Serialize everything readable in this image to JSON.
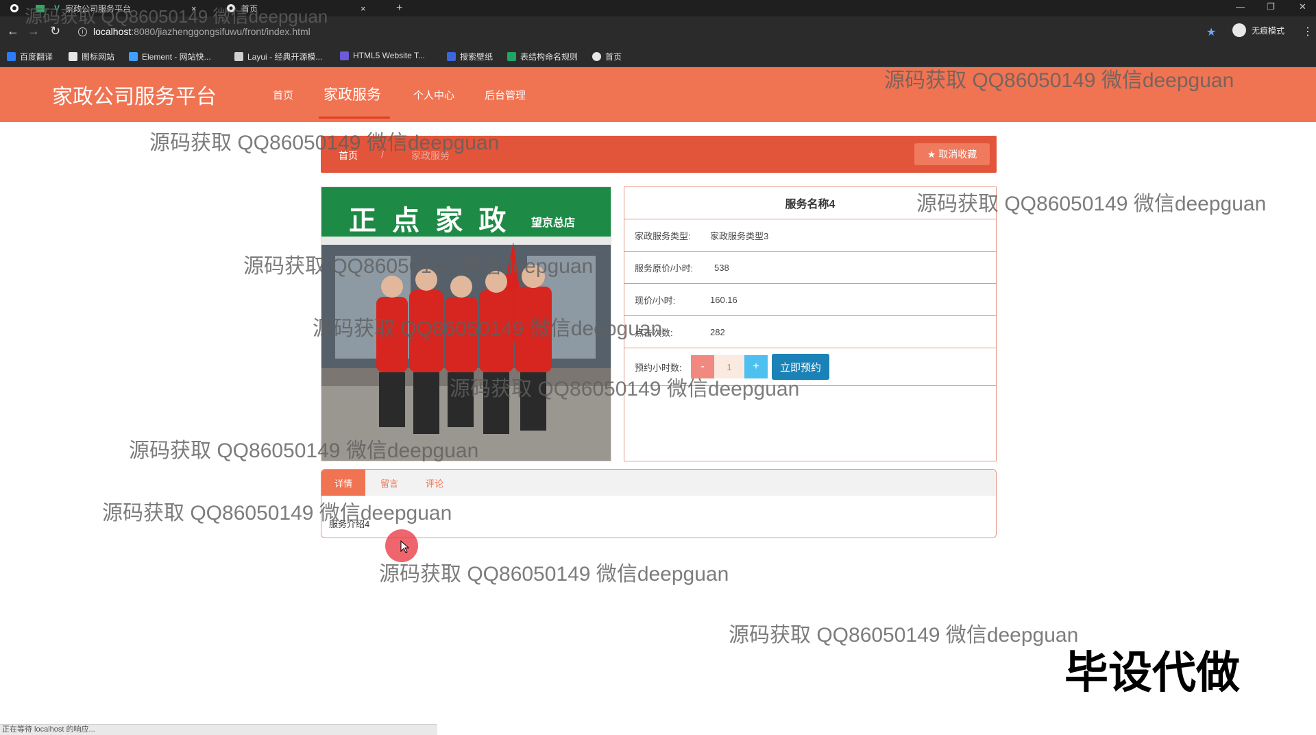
{
  "browser": {
    "tabs": [
      {
        "title": "家政公司服务平台",
        "active": false
      },
      {
        "title": "首页",
        "active": true
      }
    ],
    "new_tab": "+",
    "url_host": "localhost",
    "url_path": ":8080/jiazhenggongsifuwu/front/index.html",
    "incognito_label": "无痕模式",
    "bookmarks": [
      {
        "label": "百度翻译",
        "color": "#2e7bf6"
      },
      {
        "label": "图标网站",
        "color": "#e6e6e6"
      },
      {
        "label": "Element - 网站快...",
        "color": "#409eff"
      },
      {
        "label": "Layui - 经典开源模...",
        "color": "#cfcfcf"
      },
      {
        "label": "HTML5 Website T...",
        "color": "#6b5bd6"
      },
      {
        "label": "搜索壁纸",
        "color": "#3b67d8"
      },
      {
        "label": "表结构命名规则",
        "color": "#21a366"
      },
      {
        "label": "首页",
        "color": "#e6e6e6"
      }
    ],
    "status_text": "正在等待 localhost 的响应..."
  },
  "site": {
    "title": "家政公司服务平台",
    "nav": [
      "首页",
      "家政服务",
      "个人中心",
      "后台管理"
    ],
    "active_nav": "家政服务"
  },
  "breadcrumb": {
    "home": "首页",
    "separator": "/",
    "current": "家政服务"
  },
  "favorite_button": "★ 取消收藏",
  "service": {
    "name": "服务名称4",
    "fields": [
      {
        "label": "家政服务类型:",
        "value": "家政服务类型3"
      },
      {
        "label": "服务原价/小时:",
        "value": "538"
      },
      {
        "label": "现价/小时:",
        "value": "160.16"
      },
      {
        "label": "点击次数:",
        "value": "282"
      }
    ],
    "quantity_label": "预约小时数:",
    "quantity": "1",
    "minus": "-",
    "plus": "+",
    "book_button": "立即预约"
  },
  "photo": {
    "sign_text": "正 点 家 政",
    "sign_sub": "望京总店"
  },
  "tabs": [
    "详情",
    "留言",
    "评论"
  ],
  "detail_text": "服务介绍4",
  "watermark": "源码获取 QQ86050149 微信deepguan",
  "promo": "毕设代做",
  "colors": {
    "header": "#f07352",
    "crumbbar": "#e2553a",
    "book_button": "#1a82b6"
  }
}
